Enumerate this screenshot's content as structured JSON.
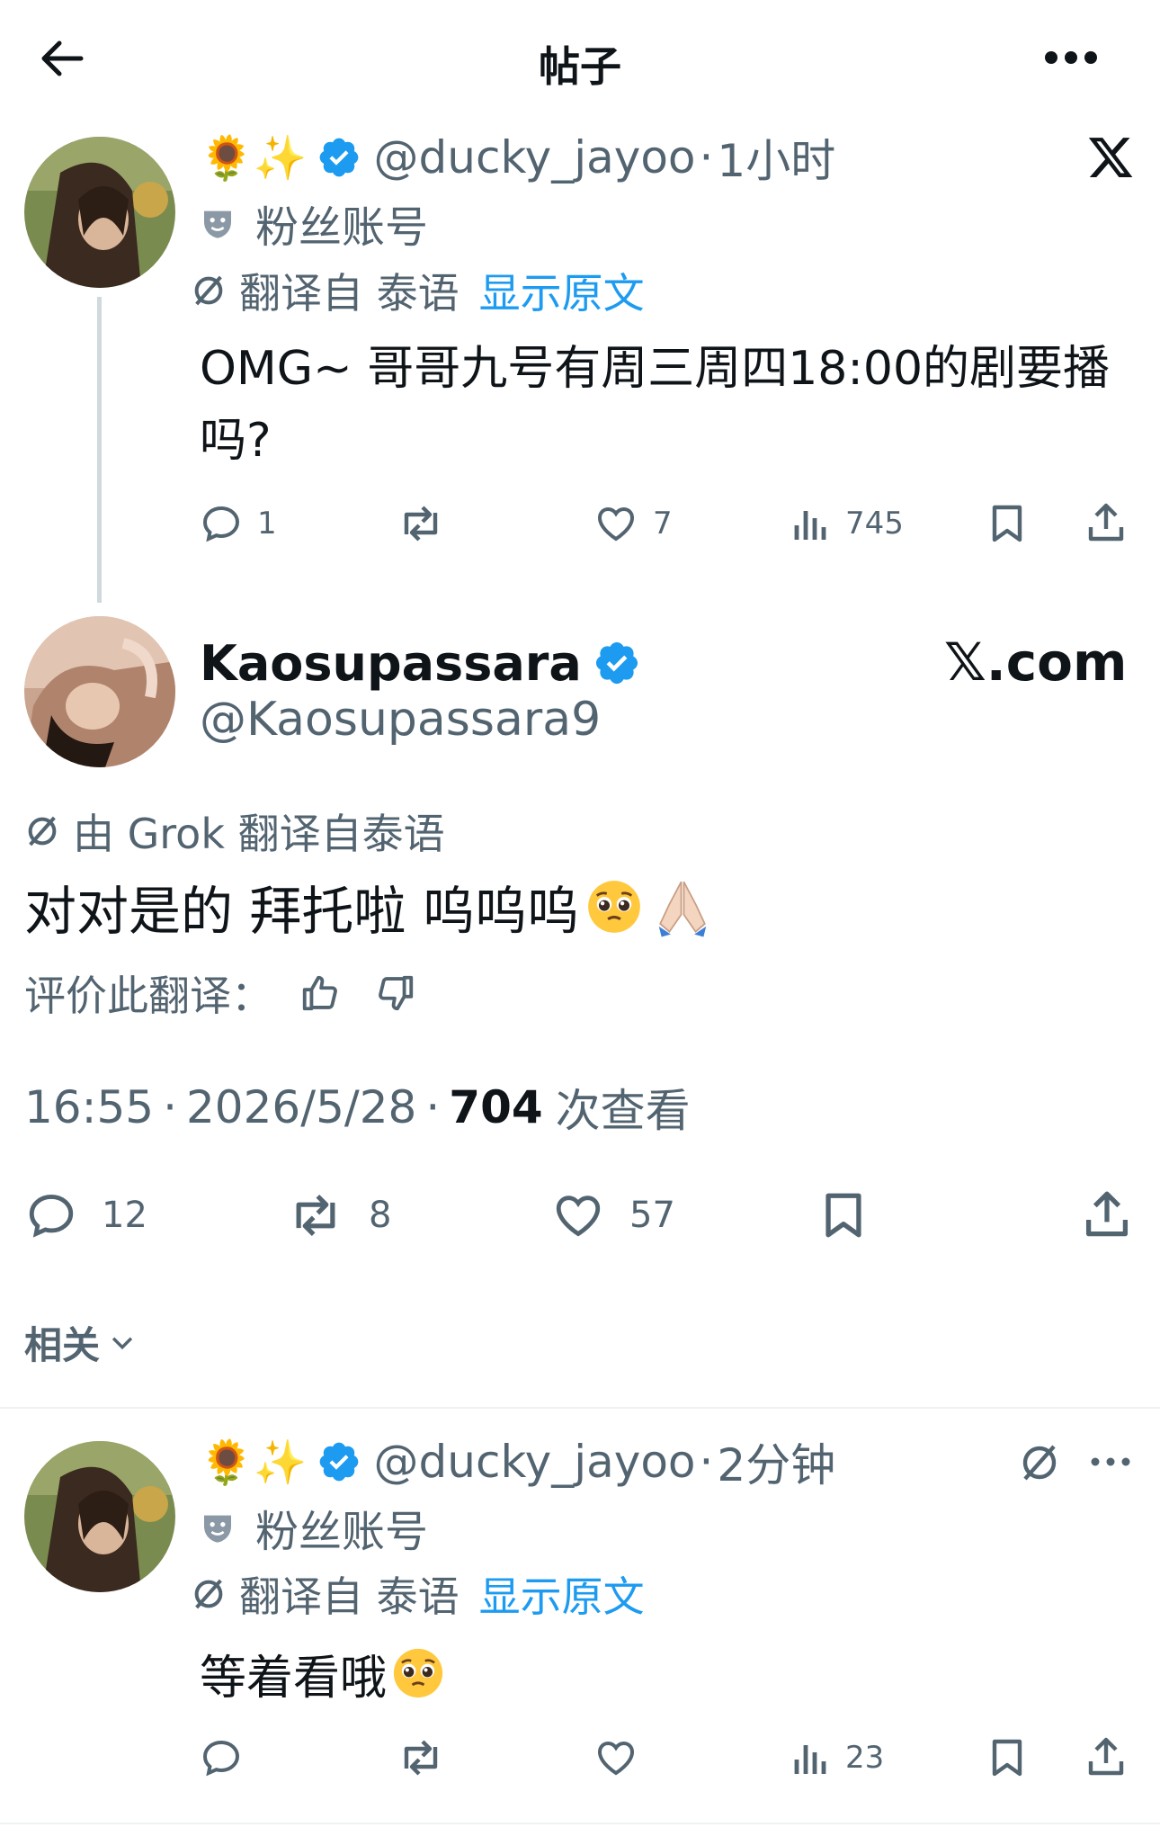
{
  "header": {
    "title": "帖子"
  },
  "reply1": {
    "emojis": "🌻✨",
    "handle": "@ducky_jayoo",
    "sep": "·",
    "time": "1小时",
    "tag": "粉丝账号",
    "translated_from": "翻译自 泰语",
    "show_original": "显示原文",
    "text": "OMG~ 哥哥九号有周三周四18:00的剧要播吗?",
    "stats": {
      "replies": "1",
      "likes": "7",
      "views": "745"
    }
  },
  "main": {
    "name": "Kaosupassara",
    "handle": "@Kaosupassara9",
    "brand": "𝕏.com",
    "translated_by": "由 Grok 翻译自泰语",
    "text": "对对是的 拜托啦 呜呜呜",
    "rate_label": "评价此翻译：",
    "time": "16:55",
    "sep": "·",
    "date": "2026/5/28",
    "views": "704",
    "views_label": "次查看",
    "stats": {
      "replies": "12",
      "reposts": "8",
      "likes": "57"
    }
  },
  "related": {
    "label": "相关"
  },
  "reply2": {
    "emojis": "🌻✨",
    "handle": "@ducky_jayoo",
    "sep": "·",
    "time": "2分钟",
    "tag": "粉丝账号",
    "translated_from": "翻译自 泰语",
    "show_original": "显示原文",
    "text": "等着看哦",
    "stats": {
      "views": "23"
    }
  },
  "colors": {
    "accent": "#1d9bf0",
    "text": "#0f1419",
    "muted": "#536471",
    "divider": "#eff3f4"
  }
}
